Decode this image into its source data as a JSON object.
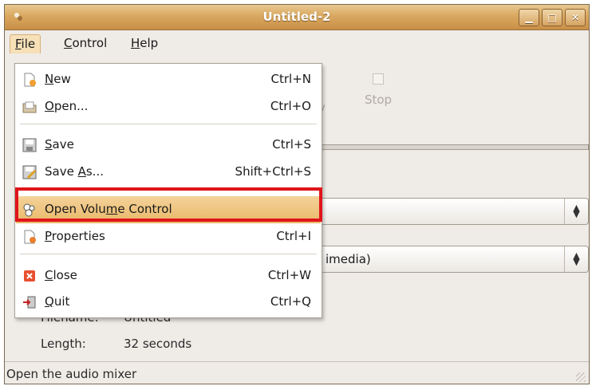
{
  "window": {
    "title": "Untitled-2",
    "buttons": [
      "minimize-icon",
      "maximize-icon",
      "close-icon"
    ]
  },
  "menubar": {
    "items": [
      {
        "label": "File",
        "mnemonic": "F"
      },
      {
        "label": "Control",
        "mnemonic": "C"
      },
      {
        "label": "Help",
        "mnemonic": "H"
      }
    ]
  },
  "toolbar": {
    "stop_label": "Stop",
    "play_tail": "y"
  },
  "content": {
    "combo2_value": "imedia)",
    "filename_key": "Filename:",
    "filename_value": "Untitled",
    "length_key": "Length:",
    "length_value": "32 seconds"
  },
  "file_menu": {
    "items": [
      {
        "icon": "new-document-icon",
        "pre": "",
        "u": "N",
        "post": "ew",
        "accel": "Ctrl+N"
      },
      {
        "icon": "open-folder-icon",
        "pre": "",
        "u": "O",
        "post": "pen...",
        "accel": "Ctrl+O"
      },
      {
        "icon": "save-disk-icon",
        "pre": "",
        "u": "S",
        "post": "ave",
        "accel": "Ctrl+S"
      },
      {
        "icon": "save-as-icon",
        "pre": "Save ",
        "u": "A",
        "post": "s...",
        "accel": "Shift+Ctrl+S"
      },
      {
        "icon": "volume-control-icon",
        "pre": "Open Volu",
        "u": "m",
        "post": "e Control",
        "accel": ""
      },
      {
        "icon": "properties-icon",
        "pre": "",
        "u": "P",
        "post": "roperties",
        "accel": "Ctrl+I"
      },
      {
        "icon": "close-red-icon",
        "pre": "",
        "u": "C",
        "post": "lose",
        "accel": "Ctrl+W"
      },
      {
        "icon": "quit-icon",
        "pre": "",
        "u": "Q",
        "post": "uit",
        "accel": "Ctrl+Q"
      }
    ]
  },
  "statusbar": {
    "text": "Open the audio mixer"
  },
  "colors": {
    "highlight": "#e9b867",
    "annotation": "#e0141a",
    "titlebar": "#d9a860"
  }
}
